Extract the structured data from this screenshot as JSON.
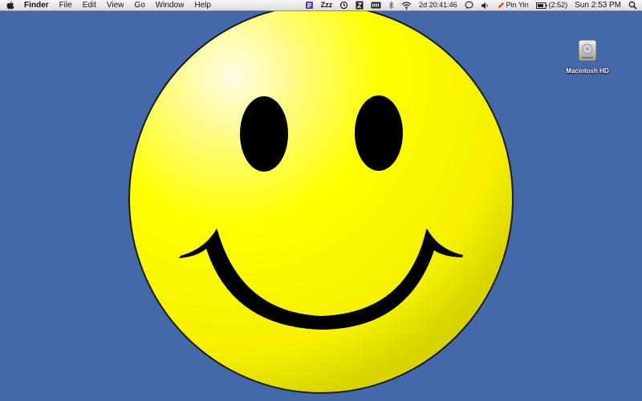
{
  "menubar": {
    "app_name": "Finder",
    "menus": [
      "File",
      "Edit",
      "View",
      "Go",
      "Window",
      "Help"
    ],
    "status": {
      "sleep_label": "Zzz",
      "uptime": "2d 20:41:46",
      "input_method": "Pin Yin",
      "battery": "(2:52)",
      "clock": "Sun 2:53 PM"
    },
    "icons": [
      "apple-icon",
      "menu-extra-icon",
      "sleep-icon",
      "time-machine-icon",
      "status-icon",
      "battery-strip-icon",
      "bluetooth-icon",
      "wifi-icon",
      "chat-icon",
      "volume-icon",
      "input-pencil-icon",
      "battery-icon",
      "spotlight-icon"
    ]
  },
  "desktop": {
    "background_color": "#4469ab",
    "wallpaper": "yellow-smiley-face",
    "face_color": "#ffff00",
    "icons": [
      {
        "label": "Macintosh HD",
        "icon": "hard-drive-icon"
      }
    ]
  }
}
